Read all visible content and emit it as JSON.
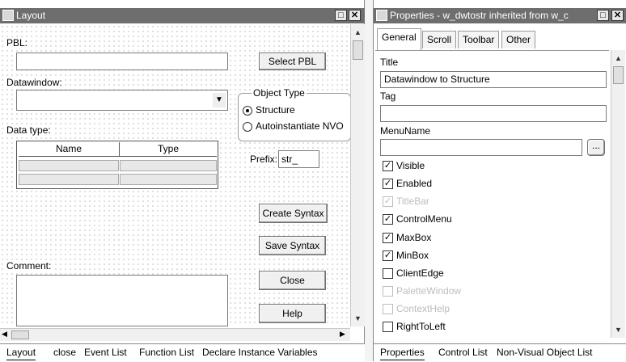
{
  "layout_window": {
    "title": "Layout",
    "pbl_label": "PBL:",
    "pbl_value": "",
    "select_pbl": "Select PBL",
    "datawindow_label": "Datawindow:",
    "datawindow_value": "",
    "object_type_group": "Object Type",
    "radio_structure": "Structure",
    "radio_nvo": "Autoinstantiate NVO",
    "selected_object_type": "Structure",
    "data_type_label": "Data type:",
    "grid_headers": [
      "Name",
      "Type"
    ],
    "prefix_label": "Prefix:",
    "prefix_value": "str_",
    "create_syntax": "Create Syntax",
    "save_syntax": "Save Syntax",
    "comment_label": "Comment:",
    "close": "Close",
    "help": "Help"
  },
  "layout_tabs": [
    "Layout",
    "close",
    "Event List",
    "Function List",
    "Declare Instance Variables"
  ],
  "properties_window": {
    "title": "Properties - w_dwtostr inherited from w_c",
    "tabs": [
      "General",
      "Scroll",
      "Toolbar",
      "Other"
    ],
    "active_tab": "General",
    "title_label": "Title",
    "title_value": "Datawindow to Structure",
    "tag_label": "Tag",
    "tag_value": "",
    "menuname_label": "MenuName",
    "menuname_value": "",
    "ellipsis": "...",
    "checkboxes": [
      {
        "label": "Visible",
        "checked": true,
        "enabled": true
      },
      {
        "label": "Enabled",
        "checked": true,
        "enabled": true
      },
      {
        "label": "TitleBar",
        "checked": true,
        "enabled": false
      },
      {
        "label": "ControlMenu",
        "checked": true,
        "enabled": true
      },
      {
        "label": "MaxBox",
        "checked": true,
        "enabled": true
      },
      {
        "label": "MinBox",
        "checked": true,
        "enabled": true
      },
      {
        "label": "ClientEdge",
        "checked": false,
        "enabled": true
      },
      {
        "label": "PaletteWindow",
        "checked": false,
        "enabled": false
      },
      {
        "label": "ContextHelp",
        "checked": false,
        "enabled": false
      },
      {
        "label": "RightToLeft",
        "checked": false,
        "enabled": true
      }
    ]
  },
  "properties_tabs": [
    "Properties",
    "Control List",
    "Non-Visual Object List"
  ],
  "icons": {
    "window": "window-icon",
    "maximize": "maximize-icon",
    "close": "close-icon",
    "dropdown": "chevron-down-icon",
    "scroll_up": "scroll-up-icon",
    "scroll_down": "scroll-down-icon",
    "scroll_left": "scroll-left-icon",
    "scroll_right": "scroll-right-icon"
  }
}
